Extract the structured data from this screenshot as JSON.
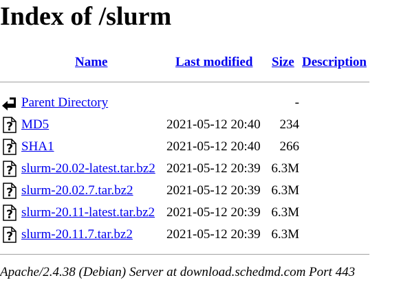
{
  "page": {
    "title": "Index of /slurm"
  },
  "columns": {
    "name": "Name",
    "last_modified": "Last modified",
    "size": "Size",
    "description": "Description"
  },
  "rows": [
    {
      "icon": "back-icon",
      "name": "Parent Directory",
      "modified": "",
      "size": "-"
    },
    {
      "icon": "unknown-file-icon",
      "name": "MD5",
      "modified": "2021-05-12 20:40",
      "size": "234"
    },
    {
      "icon": "unknown-file-icon",
      "name": "SHA1",
      "modified": "2021-05-12 20:40",
      "size": "266"
    },
    {
      "icon": "unknown-file-icon",
      "name": "slurm-20.02-latest.tar.bz2",
      "modified": "2021-05-12 20:39",
      "size": "6.3M"
    },
    {
      "icon": "unknown-file-icon",
      "name": "slurm-20.02.7.tar.bz2",
      "modified": "2021-05-12 20:39",
      "size": "6.3M"
    },
    {
      "icon": "unknown-file-icon",
      "name": "slurm-20.11-latest.tar.bz2",
      "modified": "2021-05-12 20:39",
      "size": "6.3M"
    },
    {
      "icon": "unknown-file-icon",
      "name": "slurm-20.11.7.tar.bz2",
      "modified": "2021-05-12 20:39",
      "size": "6.3M"
    }
  ],
  "footer": {
    "server": "Apache/2.4.38 (Debian) Server at download.schedmd.com Port 443"
  }
}
